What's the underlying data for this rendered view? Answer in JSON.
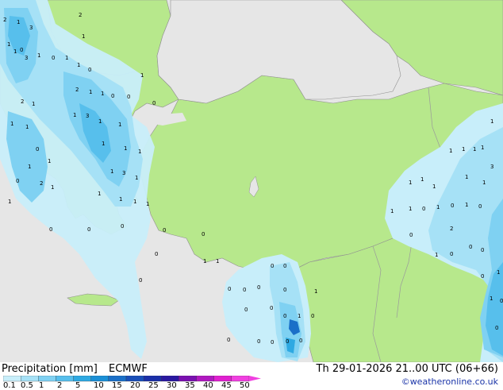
{
  "footer": {
    "title": "Precipitation [mm]",
    "model": "ECMWF",
    "datetime": "Th 29-01-2026 21..00 UTC (06+66)",
    "copyright": "©weatheronline.co.uk"
  },
  "legend": {
    "ticks": [
      "0.1",
      "0.5",
      "1",
      "2",
      "5",
      "10",
      "15",
      "20",
      "25",
      "30",
      "35",
      "40",
      "45",
      "50"
    ],
    "colors": [
      "#c8eefa",
      "#a6e1f6",
      "#7fd1f2",
      "#57bfec",
      "#2ea9e2",
      "#1a8fd6",
      "#1a6fc8",
      "#1a4fb8",
      "#1a2fa8",
      "#2a18a0",
      "#7a10b0",
      "#b018c0",
      "#e020d0",
      "#f040e0"
    ]
  },
  "map": {
    "colors": {
      "sea": "#e6e6e6",
      "land": "#b7e88c",
      "border": "#9a9a9a",
      "coast": "#909090"
    },
    "value_labels": [
      "2",
      "1",
      "3",
      "1",
      "0",
      "1",
      "3",
      "1",
      "0",
      "2",
      "1",
      "1",
      "1",
      "0",
      "1",
      "1",
      "2",
      "1",
      "1",
      "1",
      "0",
      "2",
      "1",
      "1",
      "0",
      "1",
      "3",
      "1",
      "1",
      "1",
      "1",
      "1",
      "1",
      "3",
      "1",
      "1",
      "1",
      "1",
      "0",
      "1",
      "1",
      "2",
      "1",
      "1",
      "0",
      "0",
      "0",
      "0",
      "0",
      "0",
      "0",
      "0",
      "0",
      "0",
      "0",
      "0",
      "0",
      "0",
      "0",
      "0",
      "0",
      "0",
      "0",
      "0",
      "0",
      "0",
      "0",
      "1",
      "0",
      "1",
      "1",
      "1",
      "1",
      "1",
      "1",
      "1",
      "1",
      "3",
      "1",
      "1",
      "1",
      "1",
      "1",
      "1",
      "1",
      "0",
      "1",
      "0",
      "1",
      "0",
      "0",
      "1",
      "0",
      "0",
      "0",
      "0",
      "1",
      "1",
      "0",
      "0",
      "2"
    ]
  }
}
